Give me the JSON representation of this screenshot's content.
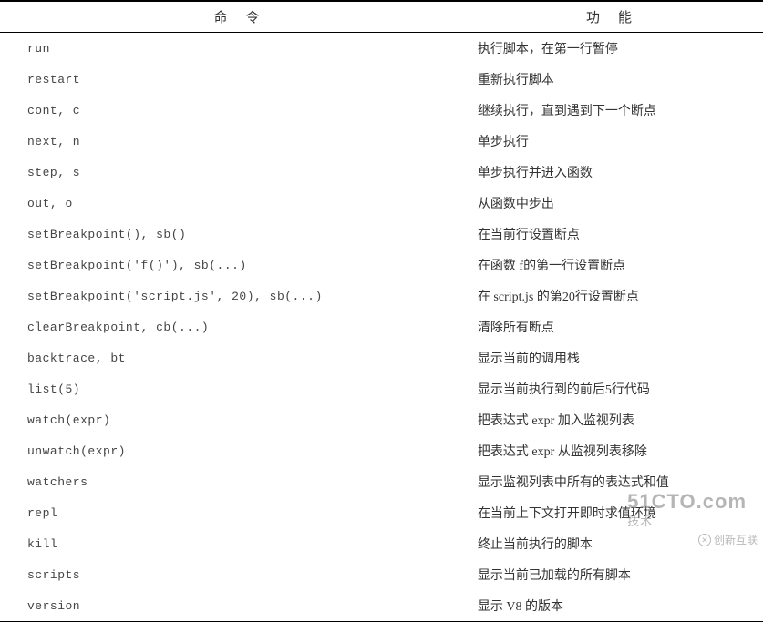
{
  "header": {
    "command": "命令",
    "function": "功能"
  },
  "rows": [
    {
      "cmd": "run",
      "func": "执行脚本，在第一行暂停"
    },
    {
      "cmd": "restart",
      "func": "重新执行脚本"
    },
    {
      "cmd": "cont, c",
      "func": "继续执行，直到遇到下一个断点"
    },
    {
      "cmd": "next, n",
      "func": "单步执行"
    },
    {
      "cmd": "step, s",
      "func": "单步执行并进入函数"
    },
    {
      "cmd": "out, o",
      "func": "从函数中步出"
    },
    {
      "cmd": "setBreakpoint(), sb()",
      "func": "在当前行设置断点"
    },
    {
      "cmd": "setBreakpoint('f()'), sb(...)",
      "func": "在函数 f的第一行设置断点"
    },
    {
      "cmd": "setBreakpoint('script.js', 20), sb(...)",
      "func": "在 script.js 的第20行设置断点"
    },
    {
      "cmd": "clearBreakpoint, cb(...)",
      "func": "清除所有断点"
    },
    {
      "cmd": "backtrace, bt",
      "func": "显示当前的调用栈"
    },
    {
      "cmd": "list(5)",
      "func": "显示当前执行到的前后5行代码"
    },
    {
      "cmd": "watch(expr)",
      "func": "把表达式 expr 加入监视列表"
    },
    {
      "cmd": "unwatch(expr)",
      "func": "把表达式 expr 从监视列表移除"
    },
    {
      "cmd": "watchers",
      "func": "显示监视列表中所有的表达式和值"
    },
    {
      "cmd": "repl",
      "func": "在当前上下文打开即时求值环境"
    },
    {
      "cmd": "kill",
      "func": "终止当前执行的脚本"
    },
    {
      "cmd": "scripts",
      "func": "显示当前已加载的所有脚本"
    },
    {
      "cmd": "version",
      "func": "显示 V8 的版本"
    }
  ],
  "watermarks": {
    "cto_main": "51CTO.com",
    "cto_sub": "技术",
    "cx_text": "创新互联",
    "cx_icon": "✕"
  }
}
